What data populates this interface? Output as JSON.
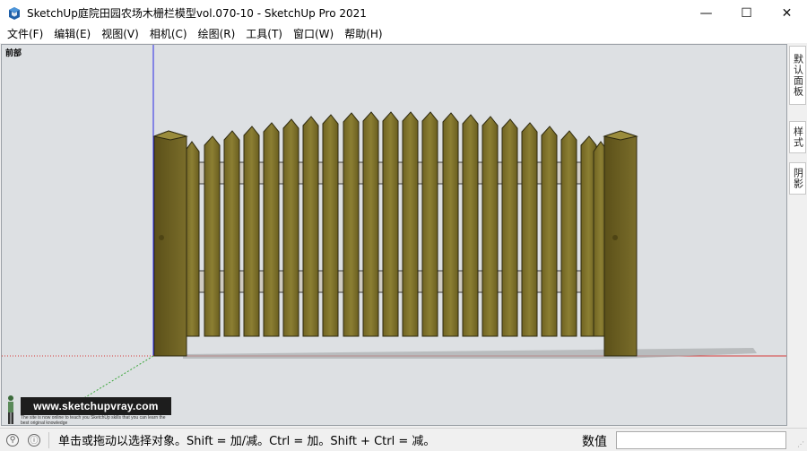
{
  "titlebar": {
    "title": "SketchUp庭院田园农场木栅栏模型vol.070-10 - SketchUp Pro 2021",
    "minimize_symbol": "—",
    "maximize_symbol": "☐",
    "close_symbol": "✕"
  },
  "menu": {
    "items": [
      {
        "label": "文件(F)"
      },
      {
        "label": "编辑(E)"
      },
      {
        "label": "视图(V)"
      },
      {
        "label": "相机(C)"
      },
      {
        "label": "绘图(R)"
      },
      {
        "label": "工具(T)"
      },
      {
        "label": "窗口(W)"
      },
      {
        "label": "帮助(H)"
      }
    ]
  },
  "viewport": {
    "scene_label": "前部",
    "background_color": "#dde0e3",
    "fence_color": "#8a7a2a",
    "axis_colors": {
      "blue": "#2a2ae6",
      "red": "#d63a3a",
      "green": "#3aa63a"
    }
  },
  "watermark": {
    "site": "www.sketchupvray.com",
    "subtext": "The site is now online to teach you SketchUp skills that you can learn the best original knowledge"
  },
  "tray": {
    "tabs": [
      {
        "label": "默认面板"
      },
      {
        "label": "样式"
      },
      {
        "label": "阴影"
      }
    ]
  },
  "status": {
    "hint": "单击或拖动以选择对象。Shift = 加/减。Ctrl = 加。Shift + Ctrl = 减。",
    "measurements_label": "数值",
    "measurements_value": "",
    "geo_icon": "geolocation-icon",
    "info_icon": "instructor-icon"
  }
}
